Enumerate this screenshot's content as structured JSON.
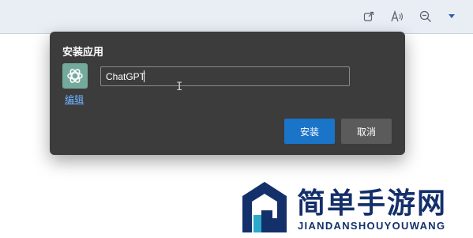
{
  "browser_toolbar": {
    "icons": [
      "external-link-icon",
      "read-aloud-icon",
      "zoom-out-icon",
      "dropdown-icon"
    ]
  },
  "dialog": {
    "title": "安装应用",
    "edit_label": "编辑",
    "app_name_value": "ChatGPT",
    "install_label": "安装",
    "cancel_label": "取消",
    "colors": {
      "background": "#3c3c3c",
      "install": "#1a74c8",
      "cancel": "#5b5b5b",
      "icon_bg": "#74aa9c"
    }
  },
  "watermark": {
    "title": "简单手游网",
    "subtitle": "JIANDANSHOUYOUWANG"
  }
}
